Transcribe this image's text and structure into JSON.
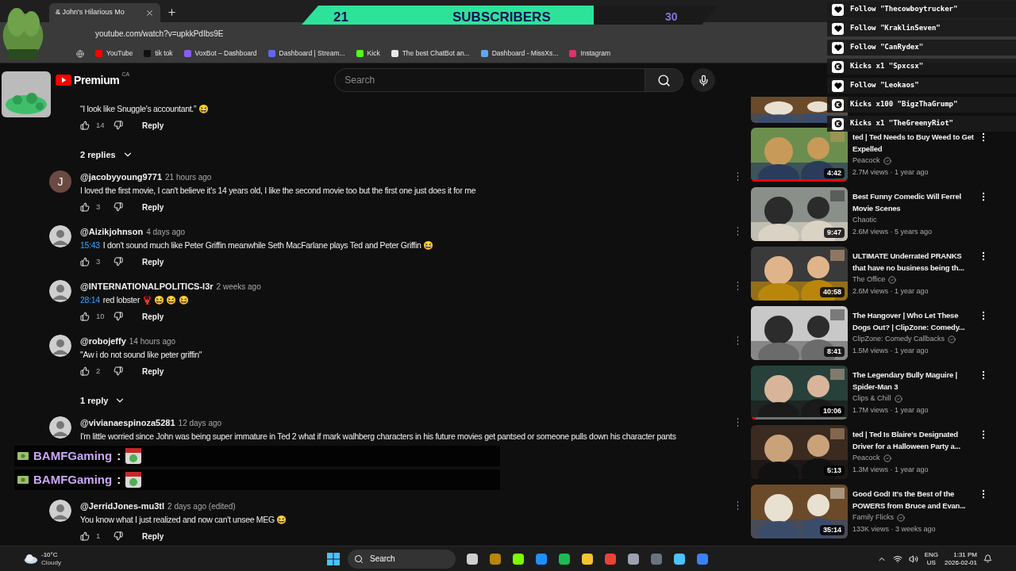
{
  "browser": {
    "tab_title": "& John's Hilarious Mo",
    "address": "youtube.com/watch?v=upkkPdIbs9E",
    "bookmarks": [
      {
        "label": "YouTube",
        "color": "#ff0000"
      },
      {
        "label": "tik tok",
        "color": "#111111"
      },
      {
        "label": "VoxBot – Dashboard",
        "color": "#8b5cf6"
      },
      {
        "label": "Dashboard | Stream...",
        "color": "#6366f1"
      },
      {
        "label": "Kick",
        "color": "#53fc18"
      },
      {
        "label": "The best ChatBot an...",
        "color": "#e5e7eb"
      },
      {
        "label": "Dashboard - MissXs...",
        "color": "#60a5fa"
      },
      {
        "label": "Instagram",
        "color": "#e1306c"
      }
    ]
  },
  "subscriber_goal": {
    "current": "21",
    "label": "SUBSCRIBERS",
    "target": "30",
    "level": 0.7
  },
  "alerts": [
    {
      "kind": "follow",
      "text": "Follow \"Thecowboytrucker\""
    },
    {
      "kind": "follow",
      "text": "Follow \"KraklinSeven\""
    },
    {
      "kind": "follow",
      "text": "Follow \"CanRydex\""
    },
    {
      "kind": "kicks",
      "text": "Kicks x1 \"Spxcsx\""
    },
    {
      "kind": "follow",
      "text": "Follow \"Leokaos\""
    },
    {
      "kind": "kicks",
      "text": "Kicks x100 \"BigzThaGrump\""
    },
    {
      "kind": "kicks",
      "text": "Kicks x1 \"TheGreenyRiot\""
    }
  ],
  "youtube": {
    "logo": "Premium",
    "region": "CA",
    "search": {
      "placeholder": "Search"
    }
  },
  "comments": [
    {
      "kind": "comment",
      "text": "“I look like Snuggle's accountant.” 😆",
      "likes": "14",
      "action": "Reply"
    },
    {
      "kind": "toggle",
      "label": "2 replies"
    },
    {
      "kind": "comment",
      "avatar": {
        "kind": "letter",
        "letter": "J",
        "color": "#6b4a44"
      },
      "handle": "@jacobyyoung9771",
      "time": "21 hours ago",
      "text": "I loved the first movie, I can't believe it's 14 years old, I like the second movie too but the first one just does it for me",
      "likes": "3",
      "action": "Reply"
    },
    {
      "kind": "comment",
      "handle": "@Aizikjohnson",
      "time": "4 days ago",
      "stamp": "15:43",
      "text": "I don't sound much like Peter Griffin meanwhile Seth MacFarlane plays Ted and Peter Griffin 😆",
      "likes": "3",
      "action": "Reply"
    },
    {
      "kind": "comment",
      "handle": "@INTERNATIONALPOLITICS-l3r",
      "time": "2 weeks ago",
      "stamp": "28:14",
      "text": "red lobster 🦞 😆 😆 😆",
      "likes": "10",
      "action": "Reply"
    },
    {
      "kind": "comment",
      "handle": "@robojeffy",
      "time": "14 hours ago",
      "text": "\"Aw i do not sound like peter griffin\"",
      "likes": "2",
      "action": "Reply"
    },
    {
      "kind": "toggle",
      "label": "1 reply"
    },
    {
      "kind": "comment",
      "handle": "@vivianaespinoza5281",
      "time": "12 days ago",
      "text": "I'm little worried since John was being super immature in Ted 2 what if mark walhberg characters in his future movies get pantsed or someone pulls down his character pants"
    },
    {
      "kind": "comment",
      "handle": "@JerridJones-mu3tl",
      "time": "2 days ago (edited)",
      "text": "You know what I just realized and now can't unsee MEG 😆",
      "likes": "1",
      "action": "Reply"
    }
  ],
  "chat": [
    {
      "user": "BAMFGaming",
      "sep": ":"
    },
    {
      "user": "BAMFGaming",
      "sep": ":"
    }
  ],
  "videos": [
    {
      "title": "ted | Ted Needs to Buy Weed to Get Expelled",
      "channel": "Peacock",
      "verified": true,
      "meta": "2.7M views · 1 year ago",
      "duration": "4:42",
      "level": 1
    },
    {
      "title": "Best Funny Comedic Will Ferrel Movie Scenes",
      "channel": "Chaotic",
      "verified": false,
      "meta": "2.6M views · 5 years ago",
      "duration": "9:47"
    },
    {
      "title": "ULTIMATE Underrated PRANKS that have no business being th...",
      "channel": "The Office",
      "verified": true,
      "meta": "2.6M views · 1 year ago",
      "duration": "40:58"
    },
    {
      "title": "The Hangover | Who Let These Dogs Out? | ClipZone: Comedy...",
      "channel": "ClipZone: Comedy Callbacks",
      "verified": true,
      "meta": "1.5M views · 1 year ago",
      "duration": "8:41"
    },
    {
      "title": "The Legendary Bully Maguire | Spider-Man 3",
      "channel": "Clips & Chill",
      "verified": true,
      "meta": "1.7M views · 1 year ago",
      "duration": "10:06",
      "level": 0.05
    },
    {
      "title": "ted | Ted Is Blaire's Designated Driver for a Halloween Party a...",
      "channel": "Peacock",
      "verified": true,
      "meta": "1.3M views · 1 year ago",
      "duration": "5:13"
    },
    {
      "title": "Good God! It's the Best of the POWERS from Bruce and Evan...",
      "channel": "Family Flicks",
      "verified": true,
      "meta": "133K views · 3 weeks ago",
      "duration": "35:14"
    }
  ],
  "taskbar": {
    "temperature": "-10°C",
    "weather": "Cloudy",
    "search": "Search",
    "lang": "ENG",
    "region": "US",
    "time": "1:31 PM",
    "date": "2026-02-01"
  }
}
